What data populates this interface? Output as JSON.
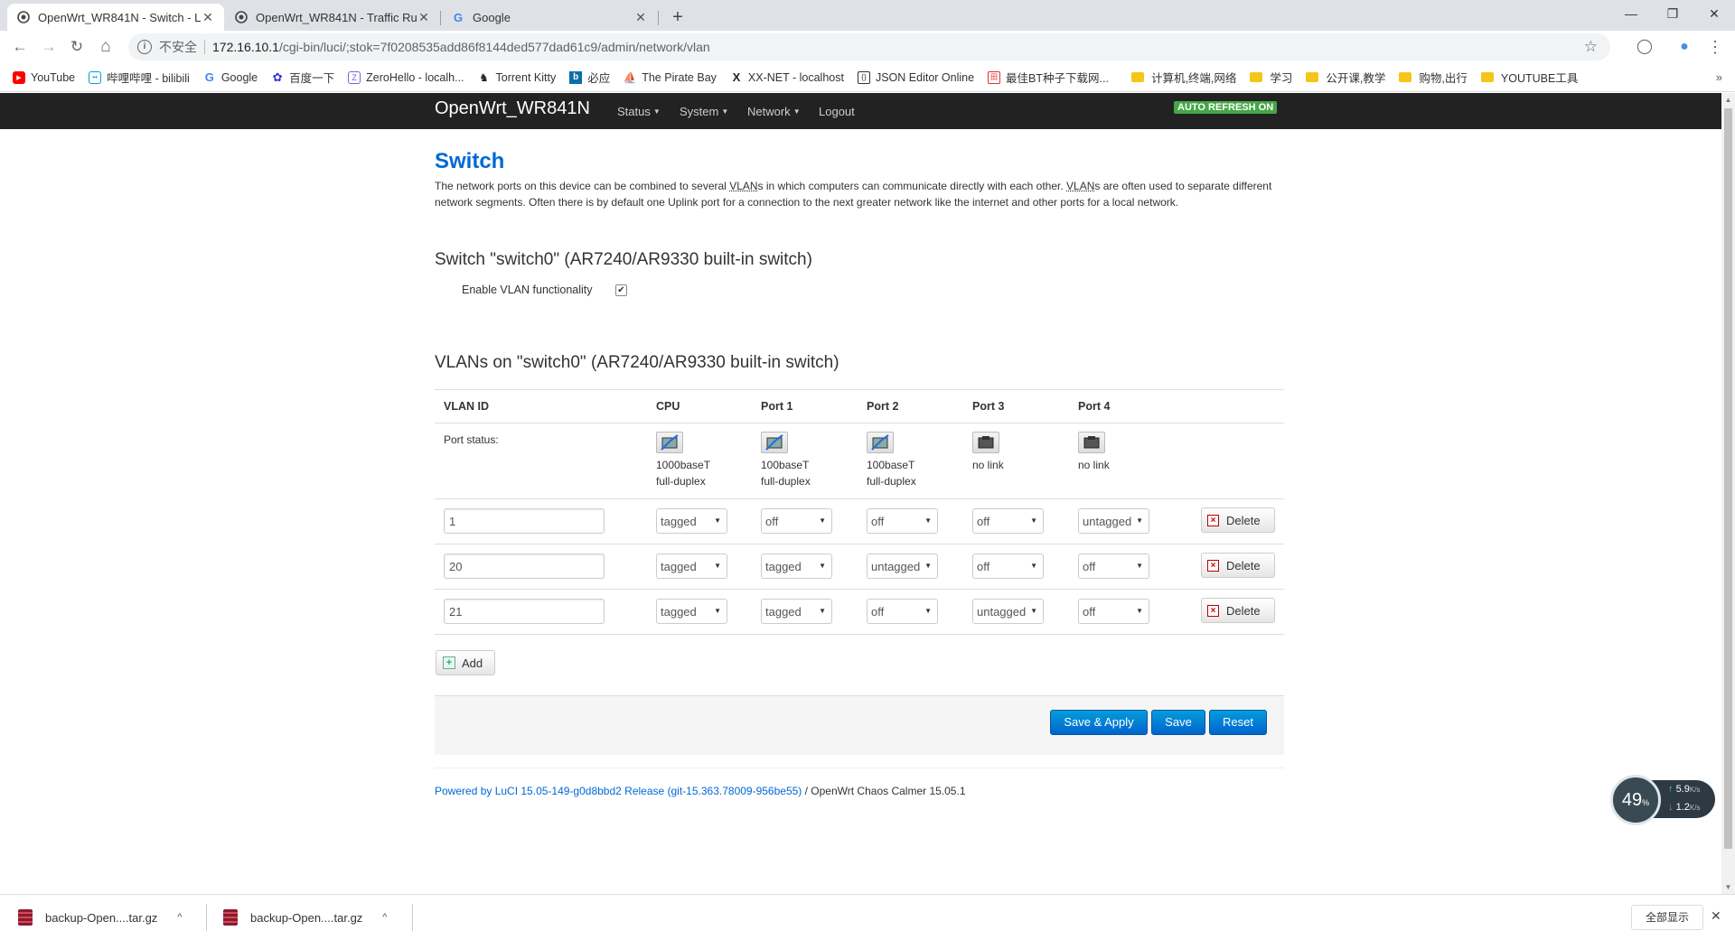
{
  "browser": {
    "tabs": [
      {
        "title": "OpenWrt_WR841N - Switch - L",
        "active": true
      },
      {
        "title": "OpenWrt_WR841N - Traffic Ru",
        "active": false
      },
      {
        "title": "Google",
        "active": false
      }
    ],
    "newtab": "+",
    "window_controls": {
      "minimize": "—",
      "maximize": "❐",
      "close": "✕"
    },
    "nav": {
      "back": "←",
      "forward": "→",
      "reload": "↻",
      "home": "⌂"
    },
    "omnibox": {
      "security": "不安全",
      "host": "172.16.10.1",
      "path": "/cgi-bin/luci/;stok=7f0208535add86f8144ded577dad61c9/admin/network/vlan"
    },
    "bookmarks": [
      {
        "label": "YouTube",
        "icon": "youtube-icon"
      },
      {
        "label": "哔哩哔哩 - bilibili",
        "icon": "bilibili-icon"
      },
      {
        "label": "Google",
        "icon": "google-icon"
      },
      {
        "label": "百度一下",
        "icon": "baidu-icon"
      },
      {
        "label": "ZeroHello - localh...",
        "icon": "zeronet-icon"
      },
      {
        "label": "Torrent Kitty",
        "icon": "torrentkitty-icon"
      },
      {
        "label": "必应",
        "icon": "bing-icon"
      },
      {
        "label": "The Pirate Bay",
        "icon": "piratebay-icon"
      },
      {
        "label": "XX-NET - localhost",
        "icon": "xxnet-icon"
      },
      {
        "label": "JSON Editor Online",
        "icon": "json-icon"
      },
      {
        "label": "最佳BT种子下载网...",
        "icon": "bt-icon"
      },
      {
        "label": "计算机,终端,网络",
        "icon": "folder-icon"
      },
      {
        "label": "学习",
        "icon": "folder-icon"
      },
      {
        "label": "公开课,教学",
        "icon": "folder-icon"
      },
      {
        "label": "购物,出行",
        "icon": "folder-icon"
      },
      {
        "label": "YOUTUBE工具",
        "icon": "folder-icon"
      }
    ],
    "bookmarks_more": "»"
  },
  "luci": {
    "brand": "OpenWrt_WR841N",
    "menu": [
      "Status",
      "System",
      "Network",
      "Logout"
    ],
    "auto_refresh": "AUTO REFRESH ON",
    "page_title": "Switch",
    "description_parts": [
      "The network ports on this device can be combined to several ",
      "VLAN",
      "s in which computers can communicate directly with each other. ",
      "VLAN",
      "s are often used to separate different network segments. Often there is by default one Uplink port for a connection to the next greater network like the internet and other ports for a local network."
    ],
    "switch_heading": "Switch \"switch0\" (AR7240/AR9330 built-in switch)",
    "enable_vlan_label": "Enable VLAN functionality",
    "enable_vlan_checked": true,
    "vlans_heading": "VLANs on \"switch0\" (AR7240/AR9330 built-in switch)",
    "columns": [
      "VLAN ID",
      "CPU",
      "Port 1",
      "Port 2",
      "Port 3",
      "Port 4"
    ],
    "port_status_label": "Port status:",
    "port_status": [
      {
        "link": true,
        "line1": "1000baseT",
        "line2": "full-duplex"
      },
      {
        "link": true,
        "line1": "100baseT",
        "line2": "full-duplex"
      },
      {
        "link": true,
        "line1": "100baseT",
        "line2": "full-duplex"
      },
      {
        "link": false,
        "line1": "no link",
        "line2": ""
      },
      {
        "link": false,
        "line1": "no link",
        "line2": ""
      }
    ],
    "vlans": [
      {
        "id": "1",
        "ports": [
          "tagged",
          "off",
          "off",
          "off",
          "untagged"
        ]
      },
      {
        "id": "20",
        "ports": [
          "tagged",
          "tagged",
          "untagged",
          "off",
          "off"
        ]
      },
      {
        "id": "21",
        "ports": [
          "tagged",
          "tagged",
          "off",
          "untagged",
          "off"
        ]
      }
    ],
    "delete_label": "Delete",
    "add_label": "Add",
    "buttons": {
      "save_apply": "Save & Apply",
      "save": "Save",
      "reset": "Reset"
    },
    "footer_link": "Powered by LuCI 15.05-149-g0d8bbd2 Release (git-15.363.78009-956be55)",
    "footer_rest": " / OpenWrt Chaos Calmer 15.05.1"
  },
  "speed_widget": {
    "percent": "49",
    "percent_unit": "%",
    "up": "5.9",
    "down": "1.2",
    "unit": "K/s"
  },
  "downloads": {
    "items": [
      {
        "name": "backup-Open....tar.gz"
      },
      {
        "name": "backup-Open....tar.gz"
      }
    ],
    "show_all": "全部显示",
    "close": "✕"
  }
}
